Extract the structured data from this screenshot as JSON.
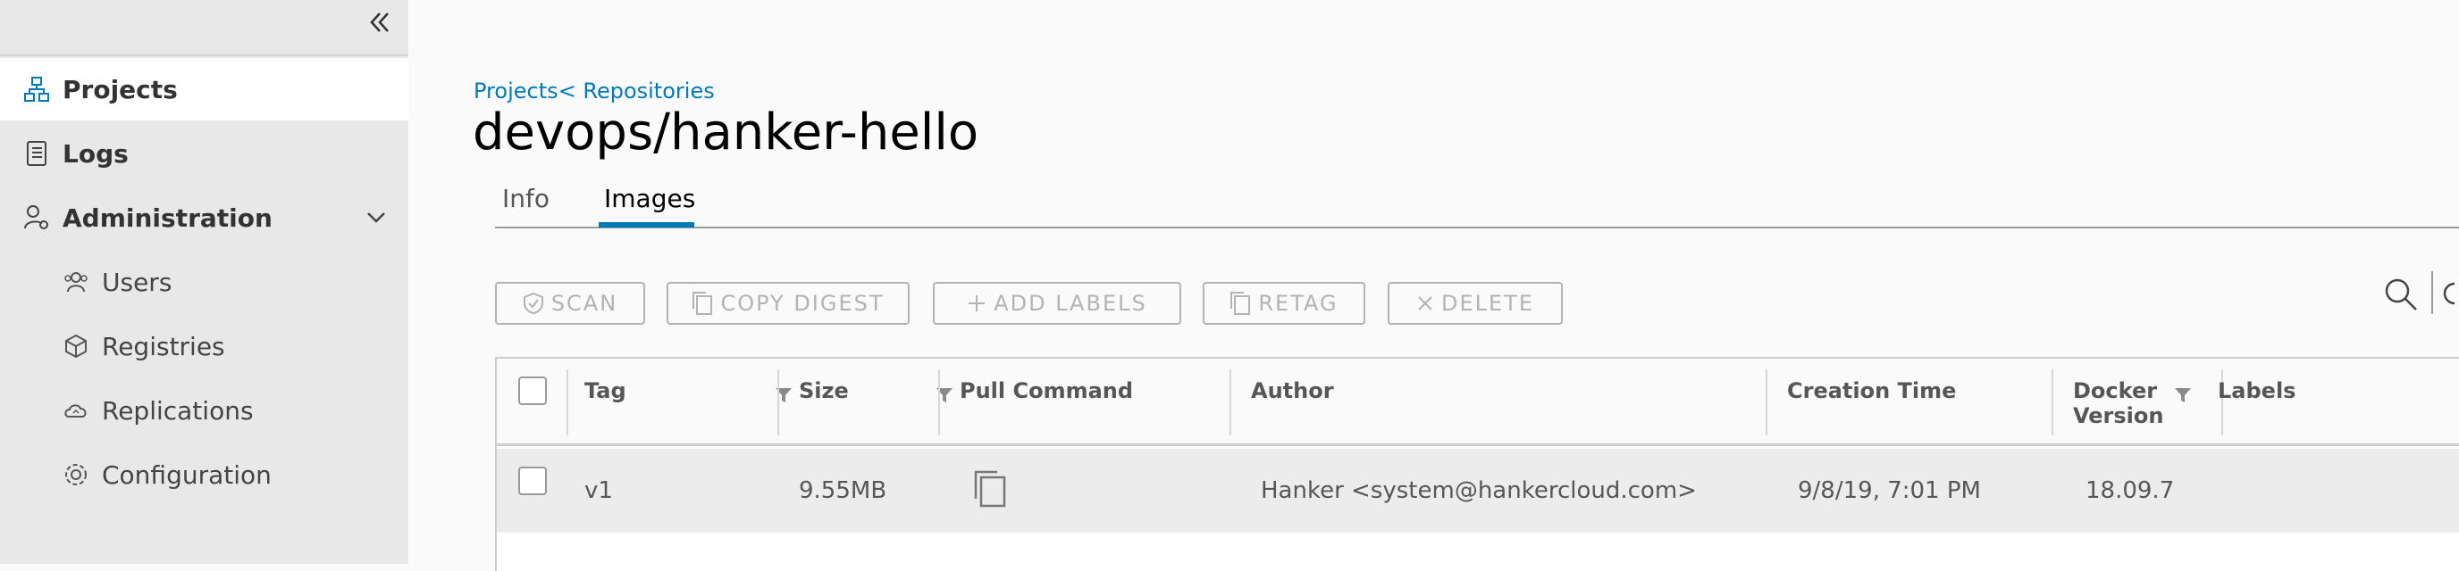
{
  "sidebar": {
    "collapse_glyph": "«",
    "items": [
      {
        "label": "Projects",
        "icon": "projects-icon"
      },
      {
        "label": "Logs",
        "icon": "logs-icon"
      },
      {
        "label": "Administration",
        "icon": "administration-icon"
      },
      {
        "label": "Users",
        "icon": "users-icon"
      },
      {
        "label": "Registries",
        "icon": "registries-icon"
      },
      {
        "label": "Replications",
        "icon": "replications-icon"
      },
      {
        "label": "Configuration",
        "icon": "configuration-icon"
      }
    ]
  },
  "header": {
    "breadcrumb": "Projects< Repositories",
    "title": "devops/hanker-hello"
  },
  "tabs": [
    {
      "label": "Info"
    },
    {
      "label": "Images"
    }
  ],
  "toolbar": {
    "scan": "SCAN",
    "copy_digest": "COPY DIGEST",
    "add_labels": "ADD LABELS",
    "retag": "RETAG",
    "delete": "DELETE"
  },
  "table": {
    "columns": [
      "Tag",
      "Size",
      "Pull Command",
      "Author",
      "Creation Time",
      "Docker Version",
      "Labels"
    ],
    "column_docker_line1": "Docker",
    "column_docker_line2": "Version",
    "rows": [
      {
        "tag": "v1",
        "size": "9.55MB",
        "author": "Hanker <system@hankercloud.com>",
        "creation_time": "9/8/19, 7:01 PM",
        "docker_version": "18.09.7"
      }
    ]
  },
  "colors": {
    "accent": "#0079b8",
    "sidebar_bg": "#e8e8e8",
    "disabled": "#b3b3b3"
  }
}
